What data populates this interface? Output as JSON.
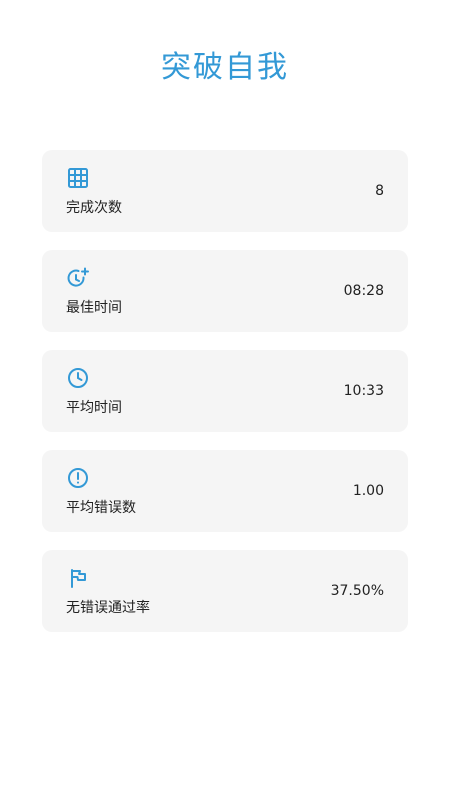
{
  "header": {
    "title": "突破自我"
  },
  "theme": {
    "accent": "#3399d6",
    "card_background": "#f5f5f5"
  },
  "stats": [
    {
      "icon": "grid-icon",
      "label": "完成次数",
      "value": "8"
    },
    {
      "icon": "timer-plus-icon",
      "label": "最佳时间",
      "value": "08:28"
    },
    {
      "icon": "clock-icon",
      "label": "平均时间",
      "value": "10:33"
    },
    {
      "icon": "alert-circle-icon",
      "label": "平均错误数",
      "value": "1.00"
    },
    {
      "icon": "flag-icon",
      "label": "无错误通过率",
      "value": "37.50%"
    }
  ]
}
